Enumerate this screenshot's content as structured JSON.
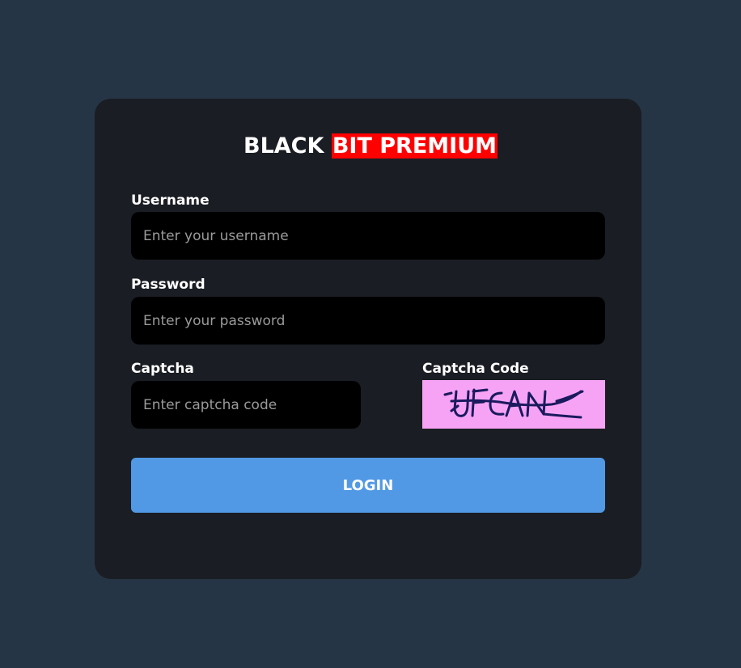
{
  "title": {
    "part1": "BLACK",
    "part2": "BIT PREMIUM",
    "highlight_color": "#ff0000"
  },
  "form": {
    "username": {
      "label": "Username",
      "placeholder": "Enter your username"
    },
    "password": {
      "label": "Password",
      "placeholder": "Enter your password"
    },
    "captcha": {
      "label": "Captcha",
      "placeholder": "Enter captcha code"
    },
    "captcha_code": {
      "label": "Captcha Code",
      "image_text": "UFCAN",
      "background_color": "#f7a3f5"
    },
    "login_label": "LOGIN",
    "login_color": "#5199e5"
  },
  "colors": {
    "page_background": "#263545",
    "card_background": "#1a1d23",
    "input_background": "#000000"
  }
}
